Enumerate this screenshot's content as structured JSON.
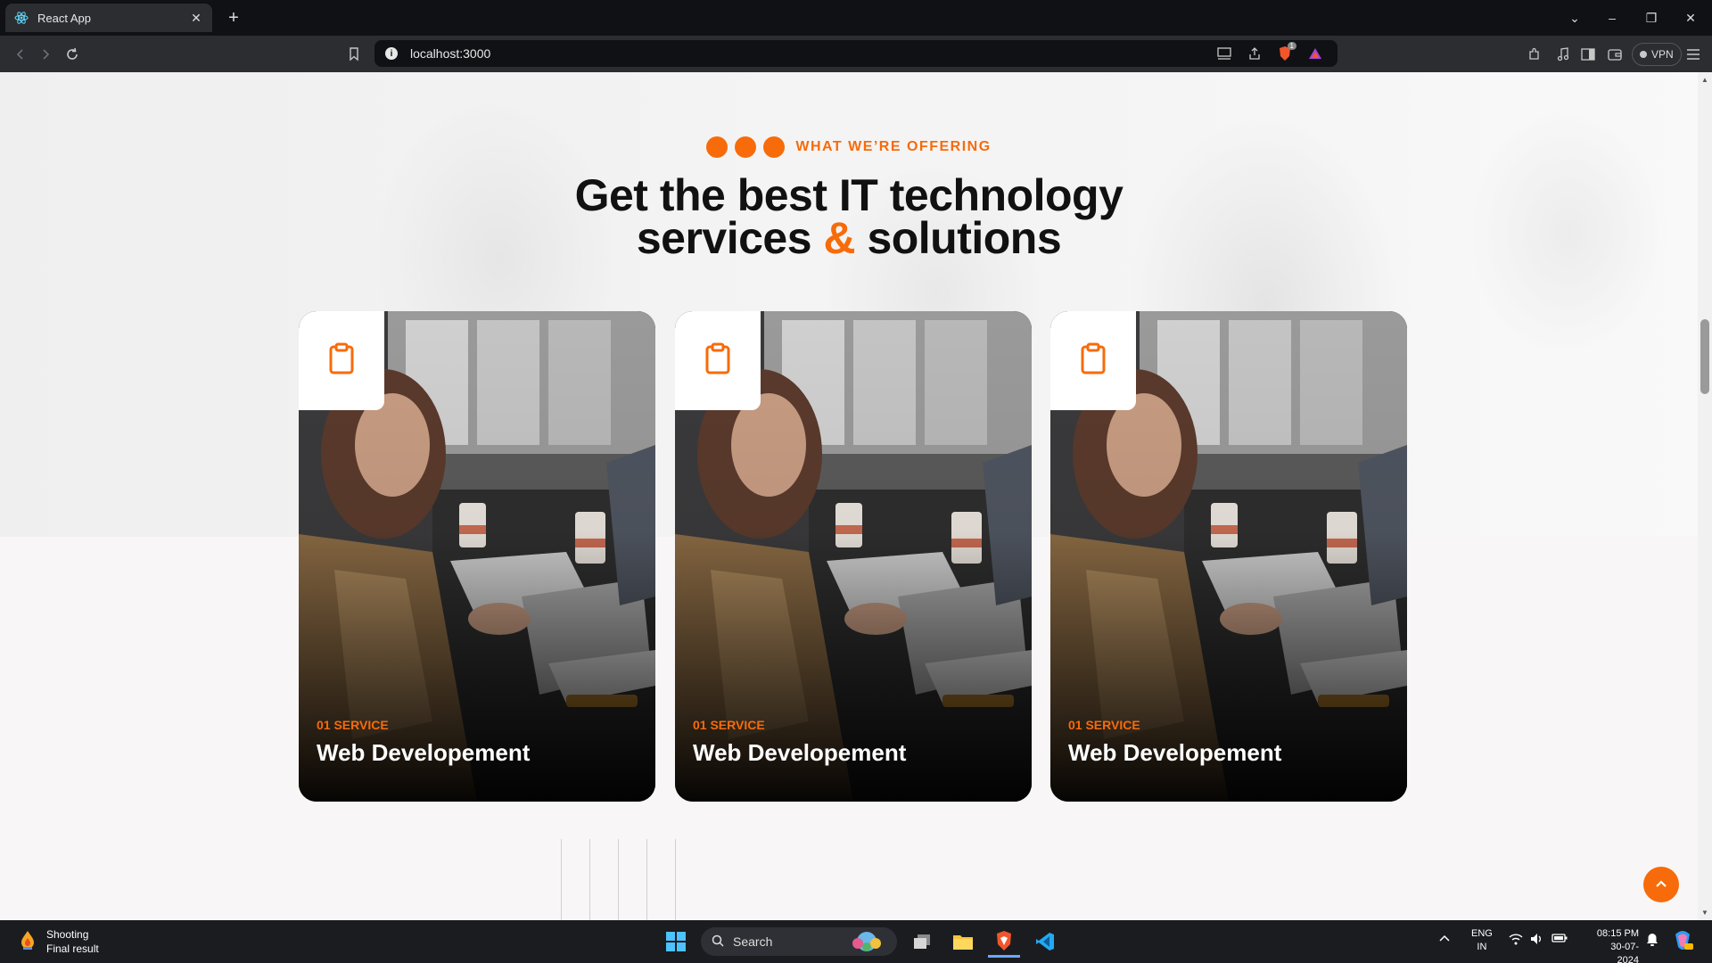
{
  "browser": {
    "tab_title": "React App",
    "url": "localhost:3000",
    "vpn_label": "VPN",
    "shields_badge": "1"
  },
  "section": {
    "subtitle": "WHAT WE’RE OFFERING",
    "heading_line1": "Get the best IT technology",
    "heading_line2_a": "services ",
    "heading_line2_amp": "&",
    "heading_line2_b": " solutions"
  },
  "cards": [
    {
      "number": "01 SERVICE",
      "title": "Web Developement",
      "icon": "clipboard-icon"
    },
    {
      "number": "01 SERVICE",
      "title": "Web Developement",
      "icon": "clipboard-icon"
    },
    {
      "number": "01 SERVICE",
      "title": "Web Developement",
      "icon": "clipboard-icon"
    }
  ],
  "colors": {
    "accent": "#f76b0a",
    "heading": "#111111",
    "page_bg": "#f8f6f7"
  },
  "taskbar": {
    "weather_title": "Shooting",
    "weather_sub": "Final result",
    "search_placeholder": "Search",
    "lang_line1": "ENG",
    "lang_line2": "IN",
    "time": "08:15 PM",
    "date": "30-07-2024"
  }
}
